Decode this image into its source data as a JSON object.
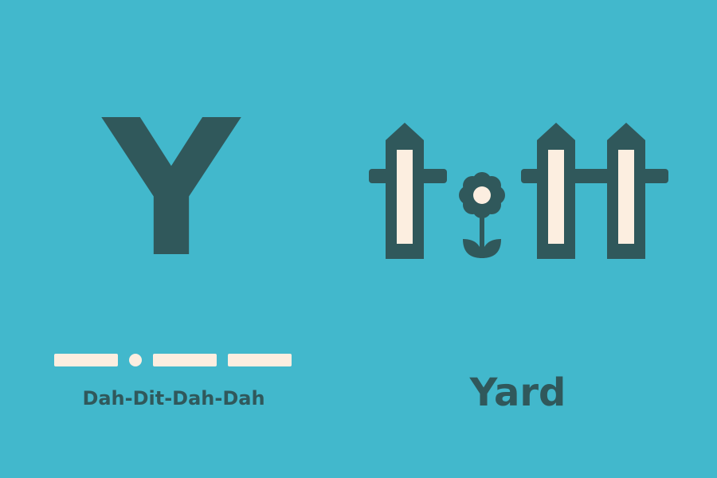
{
  "card": {
    "letter": "Y",
    "morse_code": [
      "dash",
      "dot",
      "dash",
      "dash"
    ],
    "morse_label": "Dah-Dit-Dah-Dah",
    "word": "Yard",
    "picture_icon": "fence-with-flower-icon"
  },
  "colors": {
    "background": "#42B8CC",
    "ink": "#30585B",
    "cream": "#FCEEE0"
  }
}
